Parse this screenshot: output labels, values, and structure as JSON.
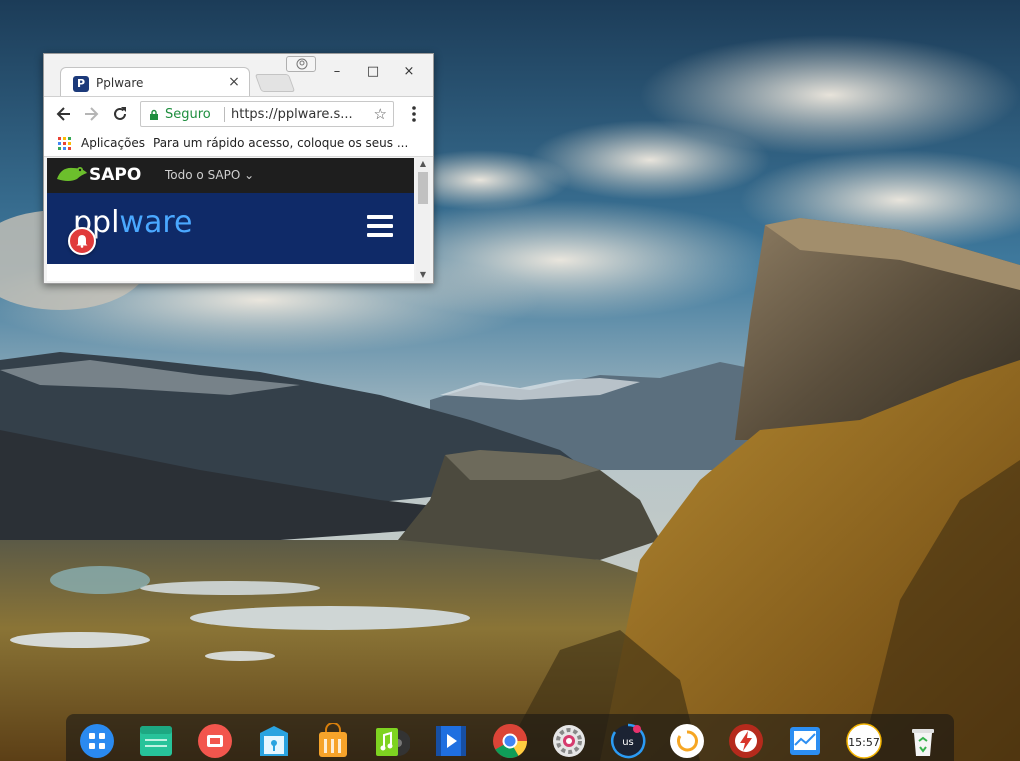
{
  "desktop": {
    "wallpaper": "mountain-valley-landscape"
  },
  "browser": {
    "tab": {
      "title": "Pplware",
      "favicon_letter": "P",
      "close_glyph": "×"
    },
    "window_controls": {
      "minimize": "–",
      "maximize": "□",
      "close": "×"
    },
    "omnibox": {
      "security_label": "Seguro",
      "url": "https://pplware.s..."
    },
    "bookmarks_bar": {
      "apps_label": "Aplicações",
      "hint": "Para um rápido acesso, coloque os seus ..."
    },
    "page": {
      "sapo_brand": "SAPO",
      "sapo_menu": "Todo o SAPO ⌄",
      "site_logo_part1": "ppl",
      "site_logo_part2": "ware"
    }
  },
  "dock": {
    "items": [
      {
        "name": "launcher-icon"
      },
      {
        "name": "file-manager-icon"
      },
      {
        "name": "screen-recorder-icon"
      },
      {
        "name": "app-store-icon"
      },
      {
        "name": "shop-bag-icon"
      },
      {
        "name": "music-player-icon"
      },
      {
        "name": "video-player-icon"
      },
      {
        "name": "chrome-icon"
      },
      {
        "name": "settings-icon"
      },
      {
        "name": "us-app-icon",
        "label": "us"
      },
      {
        "name": "power-app-icon"
      },
      {
        "name": "flash-app-icon"
      },
      {
        "name": "monitor-app-icon"
      },
      {
        "name": "clock-icon",
        "label": "15:57"
      },
      {
        "name": "trash-icon"
      }
    ]
  }
}
